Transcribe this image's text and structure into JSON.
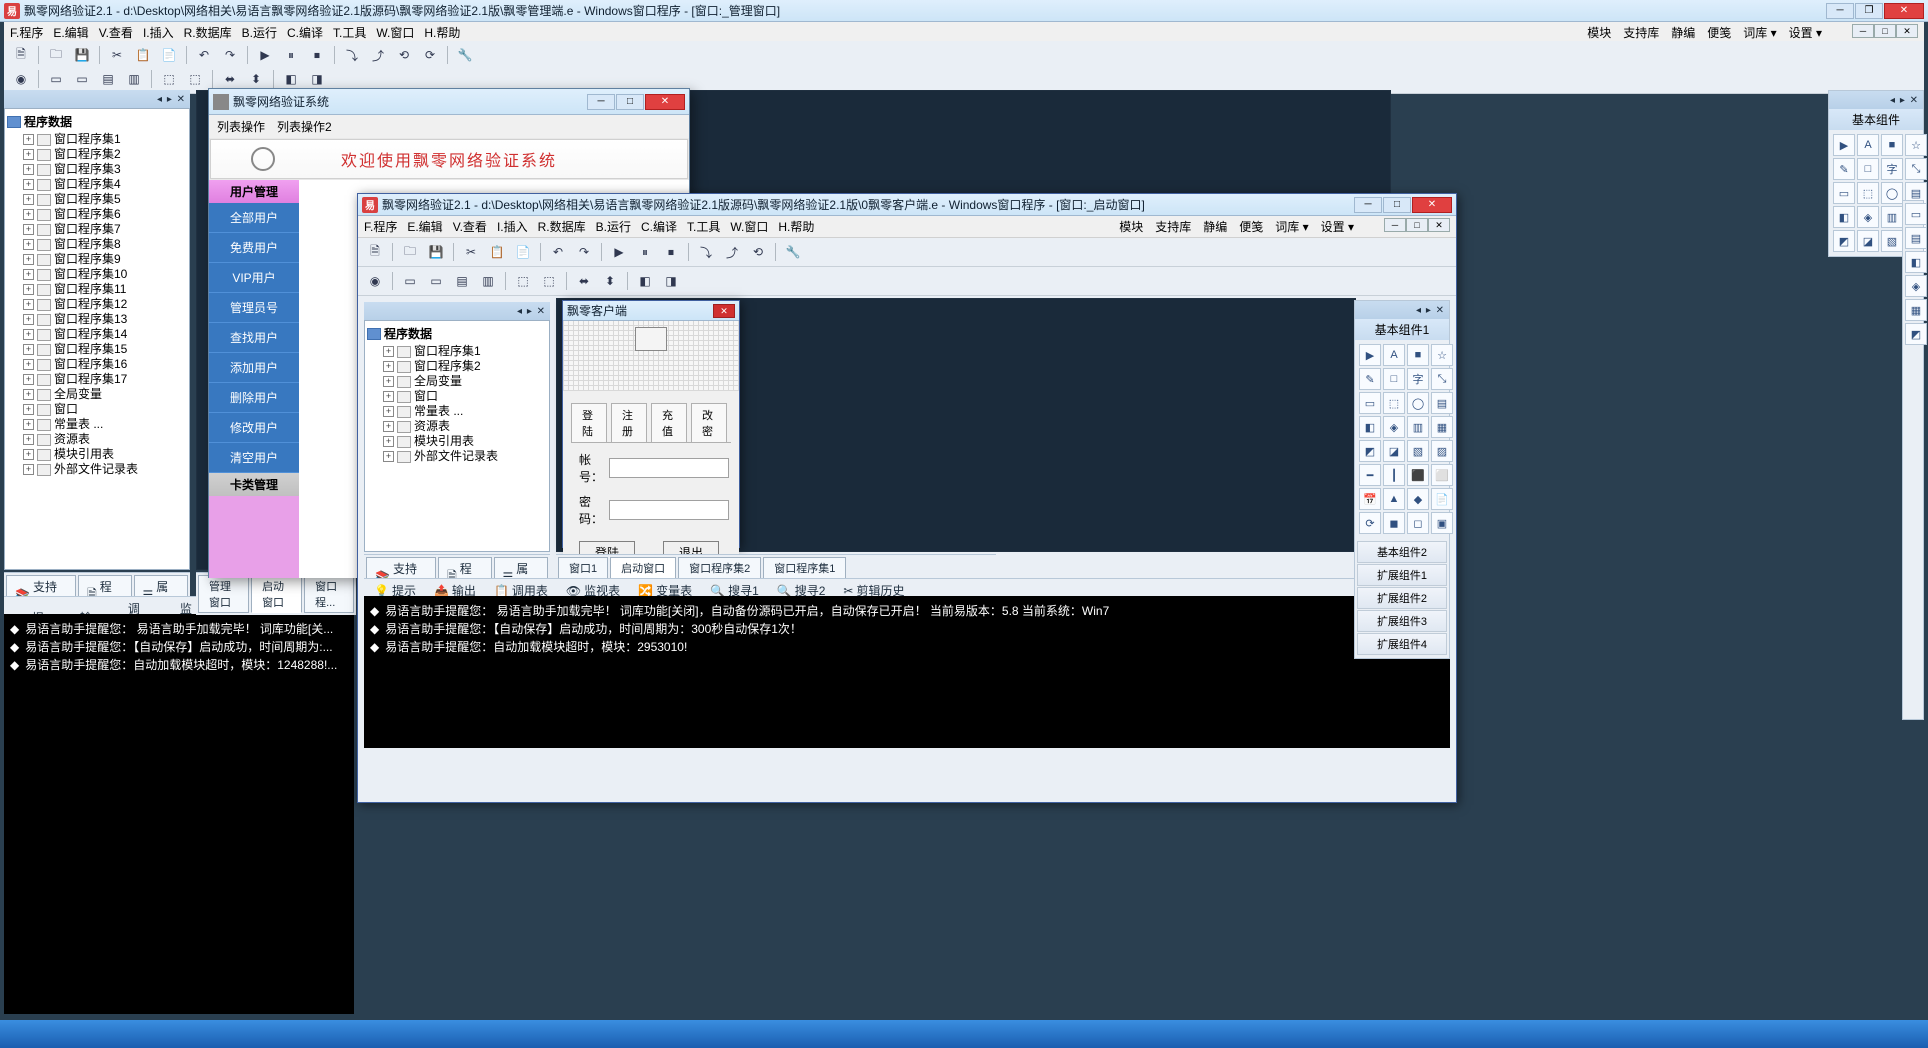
{
  "desktop": {
    "titlebar": ""
  },
  "main_window": {
    "title": "飘零网络验证2.1 - d:\\Desktop\\网络相关\\易语言飘零网络验证2.1版源码\\飘零网络验证2.1版\\飘零管理端.e - Windows窗口程序 - [窗口:_管理窗口]",
    "menu": [
      "F.程序",
      "E.编辑",
      "V.查看",
      "I.插入",
      "R.数据库",
      "B.运行",
      "C.编译",
      "T.工具",
      "W.窗口",
      "H.帮助"
    ],
    "menu_right": [
      "模块",
      "支持库",
      "静编",
      "便笺",
      "词库 ▾",
      "设置 ▾"
    ]
  },
  "second_window": {
    "title": "飘零网络验证2.1 - d:\\Desktop\\网络相关\\易语言飘零网络验证2.1版源码\\飘零网络验证2.1版\\0飘零客户端.e - Windows窗口程序 - [窗口:_启动窗口]",
    "menu": [
      "F.程序",
      "E.编辑",
      "V.查看",
      "I.插入",
      "R.数据库",
      "B.运行",
      "C.编译",
      "T.工具",
      "W.窗口",
      "H.帮助"
    ],
    "menu_right": [
      "模块",
      "支持库",
      "静编",
      "便笺",
      "词库 ▾",
      "设置 ▾"
    ]
  },
  "tree_main": {
    "root": "程序数据",
    "items": [
      "窗口程序集1",
      "窗口程序集2",
      "窗口程序集3",
      "窗口程序集4",
      "窗口程序集5",
      "窗口程序集6",
      "窗口程序集7",
      "窗口程序集8",
      "窗口程序集9",
      "窗口程序集10",
      "窗口程序集11",
      "窗口程序集12",
      "窗口程序集13",
      "窗口程序集14",
      "窗口程序集15",
      "窗口程序集16",
      "窗口程序集17",
      "全局变量",
      "窗口",
      "常量表 ...",
      "资源表",
      "模块引用表",
      "外部文件记录表"
    ]
  },
  "tree_second": {
    "root": "程序数据",
    "items": [
      "窗口程序集1",
      "窗口程序集2",
      "全局变量",
      "窗口",
      "常量表 ...",
      "资源表",
      "模块引用表",
      "外部文件记录表"
    ]
  },
  "sys_window": {
    "title": "飘零网络验证系统",
    "row_labels": [
      "列表操作",
      "列表操作2"
    ],
    "banner": "欢迎使用飘零网络验证系统",
    "section1": "用户管理",
    "section1_items": [
      "全部用户",
      "免费用户",
      "VIP用户",
      "管理员号",
      "查找用户",
      "添加用户",
      "删除用户",
      "修改用户",
      "清空用户"
    ],
    "section2": "卡类管理"
  },
  "client_dialog": {
    "title": "飘零客户端",
    "tabs": [
      "登陆",
      "注册",
      "充值",
      "改密"
    ],
    "lbl_user": "帐号：",
    "lbl_pass": "密码：",
    "btn_login": "登陆",
    "btn_exit": "退出"
  },
  "sidetabs_main": [
    "支持库",
    "程序",
    "属性"
  ],
  "sidetabs_second": [
    "支持库",
    "程序",
    "属性"
  ],
  "bottom_tabs_main": [
    "管理窗口",
    "启动窗口",
    "窗口程..."
  ],
  "bottom_tabs_second": [
    "窗口1",
    "启动窗口",
    "窗口程序集2",
    "窗口程序集1"
  ],
  "logtabs": [
    "提示",
    "输出",
    "调用表",
    "监视表",
    "变量表",
    "搜寻1",
    "搜寻2",
    "剪辑历史"
  ],
  "log_main": [
    "易语言助手提醒您：  易语言助手加载完毕！ 词库功能[关...",
    "",
    "易语言助手提醒您：【自动保存】启动成功，时间周期为:...",
    "易语言助手提醒您：自动加载模块超时，模块：1248288!..."
  ],
  "log_second": [
    "易语言助手提醒您：  易语言助手加载完毕！ 词库功能[关闭]，自动备份源码已开启，自动保存已开启！  当前易版本：5.8   当前系统：Win7",
    "",
    "易语言助手提醒您：【自动保存】启动成功，时间周期为：300秒自动保存1次！",
    "易语言助手提醒您：自动加载模块超时，模块：2953010!"
  ],
  "palette": {
    "title1": "基本组件",
    "title2": "基本组件1",
    "tabs": [
      "基本组件2",
      "扩展组件1",
      "扩展组件2",
      "扩展组件3",
      "扩展组件4"
    ],
    "icons": [
      "▶",
      "A",
      "■",
      "☆",
      "✎",
      "□",
      "字",
      "⤡",
      "▭",
      "⬚",
      "◯",
      "▤",
      "◧",
      "◈",
      "▥",
      "▦",
      "◩",
      "◪",
      "▧",
      "▨",
      "━",
      "┃",
      "⬛",
      "⬜",
      "📅",
      "▲",
      "◆",
      "📄",
      "⟳",
      "◼",
      "◻",
      "▣"
    ]
  }
}
